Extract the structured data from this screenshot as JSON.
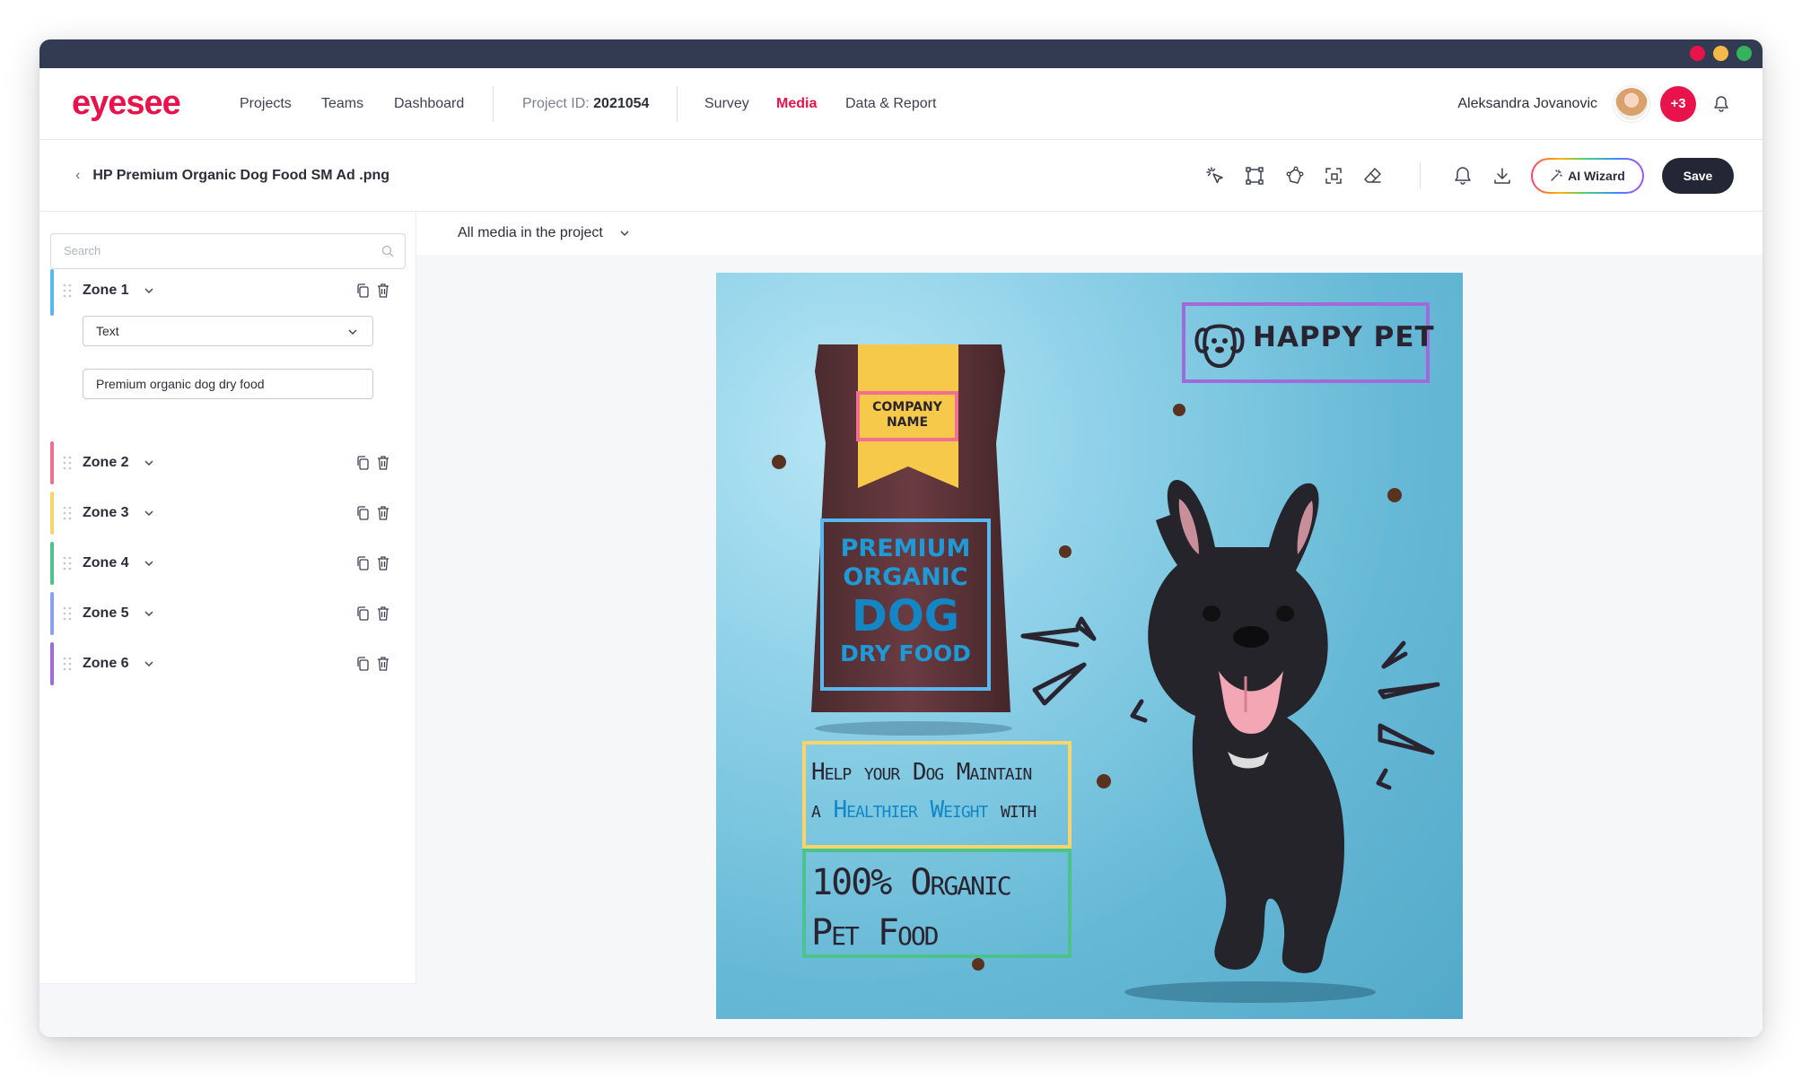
{
  "window": {
    "controls": {
      "close_color": "#e8134b",
      "min_color": "#f5b94a",
      "max_color": "#33b35a"
    }
  },
  "header": {
    "logo": "eyesee",
    "nav": [
      "Projects",
      "Teams",
      "Dashboard"
    ],
    "project_id_label": "Project ID:",
    "project_id_value": "2021054",
    "tabs": [
      "Survey",
      "Media",
      "Data & Report"
    ],
    "active_tab": "Media",
    "user_name": "Aleksandra Jovanovic",
    "extra_users": "+3"
  },
  "toolbar": {
    "file_title": "HP Premium Organic Dog Food SM Ad .png",
    "tools": [
      "magic-select-icon",
      "rectangle-icon",
      "polygon-icon",
      "crop-icon",
      "eraser-icon",
      "bell-icon",
      "download-icon"
    ],
    "ai_wizard_label": "AI Wizard",
    "save_label": "Save"
  },
  "sidebar": {
    "search_placeholder": "Search",
    "zones": [
      {
        "name": "Zone 1",
        "color": "#5ab8f0",
        "expanded": true,
        "type": "Text",
        "value": "Premium organic dog dry food"
      },
      {
        "name": "Zone 2",
        "color": "#f0708f",
        "expanded": false
      },
      {
        "name": "Zone 3",
        "color": "#f7d56a",
        "expanded": false
      },
      {
        "name": "Zone 4",
        "color": "#4cc38a",
        "expanded": false
      },
      {
        "name": "Zone 5",
        "color": "#8aa0f0",
        "expanded": false
      },
      {
        "name": "Zone 6",
        "color": "#a06ad8",
        "expanded": false
      }
    ]
  },
  "media": {
    "selector_label": "All media in the project",
    "ad": {
      "brand": "HAPPY PET",
      "company": "COMPANY NAME",
      "bag_lines": [
        "PREMIUM",
        "ORGANIC",
        "DOG",
        "DRY FOOD"
      ],
      "tagline_1": "Help your Dog Maintain",
      "tagline_2_prefix": "a ",
      "tagline_2_highlight": "Healthier Weight",
      "tagline_2_suffix": " with",
      "organic_1": "100% Organic",
      "organic_2": "Pet Food"
    }
  }
}
